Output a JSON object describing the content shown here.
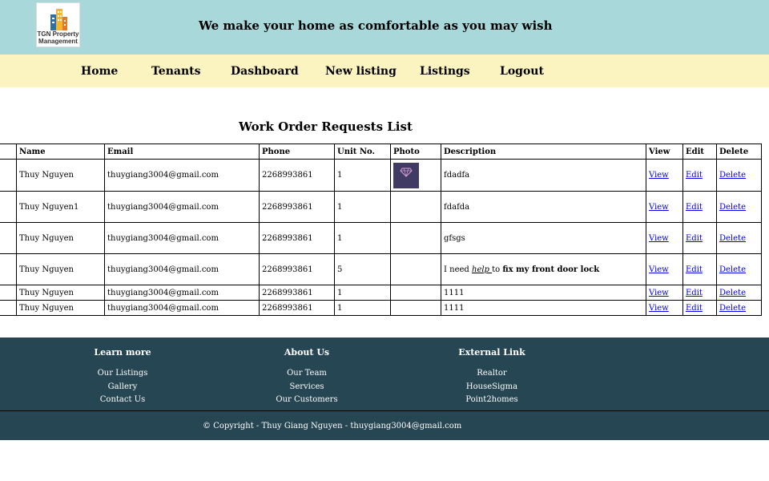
{
  "header": {
    "logo_line1": "TGN Property",
    "logo_line2": "Management",
    "tagline": "We make your home as comfortable as you may wish"
  },
  "nav": {
    "items": [
      "Home",
      "Tenants",
      "Dashboard",
      "New listing",
      "Listings",
      "Logout"
    ]
  },
  "page_title": "Work Order Requests List",
  "table": {
    "headers": [
      "Name",
      "Email",
      "Phone",
      "Unit No.",
      "Photo",
      "Description",
      "View",
      "Edit",
      "Delete"
    ],
    "rows": [
      {
        "name": "Thuy Nguyen",
        "email": "thuygiang3004@gmail.com",
        "phone": "2268993861",
        "unit": "1",
        "description": "fdadfa",
        "view": "View",
        "edit": "Edit",
        "delete": "Delete"
      },
      {
        "name": "Thuy Nguyen1",
        "email": "thuygiang3004@gmail.com",
        "phone": "2268993861",
        "unit": "1",
        "description": "fdafda",
        "view": "View",
        "edit": "Edit",
        "delete": "Delete"
      },
      {
        "name": "Thuy Nguyen",
        "email": "thuygiang3004@gmail.com",
        "phone": "2268993861",
        "unit": "1",
        "description": "gfsgs",
        "view": "View",
        "edit": "Edit",
        "delete": "Delete"
      },
      {
        "name": "Thuy Nguyen",
        "email": "thuygiang3004@gmail.com",
        "phone": "2268993861",
        "unit": "5",
        "desc_part1": "I need ",
        "desc_part2": "help ",
        "desc_part3": "to ",
        "desc_part4": "fix my front door lock",
        "view": "View",
        "edit": "Edit",
        "delete": "Delete"
      },
      {
        "name": "Thuy Nguyen",
        "email": "thuygiang3004@gmail.com",
        "phone": "2268993861",
        "unit": "1",
        "description": "1111",
        "view": "View",
        "edit": "Edit",
        "delete": "Delete"
      },
      {
        "name": "Thuy Nguyen",
        "email": "thuygiang3004@gmail.com",
        "phone": "2268993861",
        "unit": "1",
        "description": "1111",
        "view": "View",
        "edit": "Edit",
        "delete": "Delete"
      }
    ]
  },
  "footer": {
    "learn_more": {
      "title": "Learn more",
      "links": [
        "Our Listings",
        "Gallery",
        "Contact Us"
      ]
    },
    "about_us": {
      "title": "About Us",
      "links": [
        "Our Team",
        "Services",
        "Our Customers"
      ]
    },
    "external_link": {
      "title": "External Link",
      "links": [
        "Realtor",
        "HouseSigma",
        "Point2homes"
      ]
    },
    "copyright": "© Copyright - Thuy Giang Nguyen - thuygiang3004@gmail.com"
  },
  "colors": {
    "header_bg": "#a8d8da",
    "nav_bg": "#fbf3c0",
    "footer_bg": "#264653",
    "link": "#0000ee"
  }
}
